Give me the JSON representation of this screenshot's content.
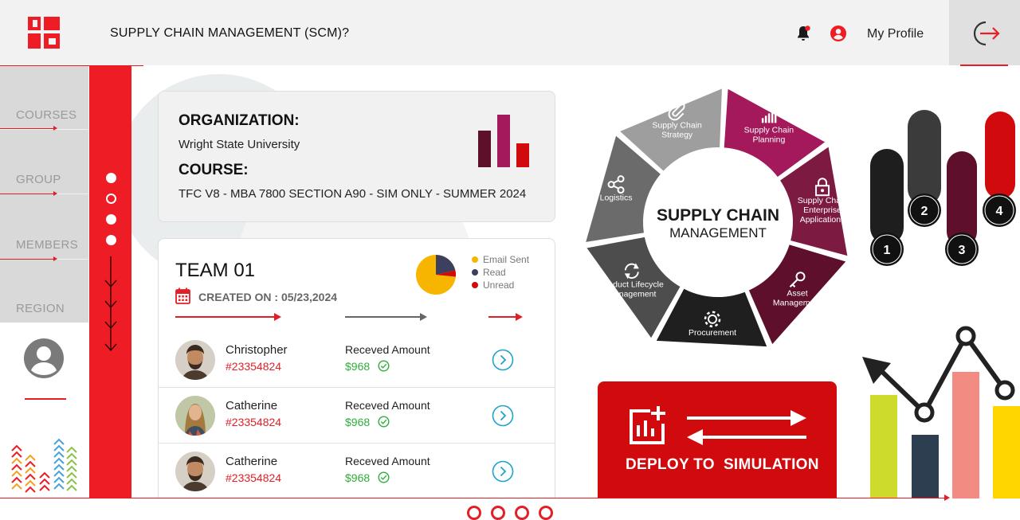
{
  "header": {
    "title": "SUPPLY CHAIN MANAGEMENT (SCM)?",
    "profile_label": "My Profile"
  },
  "sidebar": {
    "items": [
      {
        "label": "COURSES"
      },
      {
        "label": "GROUP"
      },
      {
        "label": "MEMBERS"
      },
      {
        "label": "REGION"
      }
    ]
  },
  "organization": {
    "org_heading": "ORGANIZATION:",
    "org_value": "Wright State University",
    "course_heading": "COURSE:",
    "course_value": "TFC V8 - MBA 7800 SECTION A90 - SIM ONLY - SUMMER 2024"
  },
  "team": {
    "title": "TEAM 01",
    "created": "CREATED ON : 05/23,2024",
    "legend": [
      {
        "label": "Email Sent",
        "color": "#f7b500"
      },
      {
        "label": "Read",
        "color": "#3d3f5e"
      },
      {
        "label": "Unread",
        "color": "#d10a0e"
      }
    ],
    "members": [
      {
        "name": "Christopher",
        "id": "#23354824",
        "amount_label": "Receved Amount",
        "amount": "$968"
      },
      {
        "name": "Catherine",
        "id": "#23354824",
        "amount_label": "Receved Amount",
        "amount": "$968"
      },
      {
        "name": "Catherine",
        "id": "#23354824",
        "amount_label": "Receved Amount",
        "amount": "$968"
      }
    ]
  },
  "scm_wheel": {
    "center_line1": "SUPPLY CHAIN",
    "center_line2": "MANAGEMENT",
    "segments": [
      {
        "line1": "Supply Chain",
        "line2": "Planning",
        "line3": "",
        "icon": "bar-chart-icon",
        "color": "#a3195b"
      },
      {
        "line1": "Supply Chain",
        "line2": "Enterprise",
        "line3": "Applications",
        "icon": "lock-icon",
        "color": "#7d1a42"
      },
      {
        "line1": "Asset",
        "line2": "Management",
        "line3": "",
        "icon": "key-icon",
        "color": "#5e0f2b"
      },
      {
        "line1": "Procurement",
        "line2": "",
        "line3": "",
        "icon": "gear-icon",
        "color": "#1f1f1f"
      },
      {
        "line1": "Product Lifecycle",
        "line2": "Management",
        "line3": "",
        "icon": "refresh-icon",
        "color": "#4d4d4d"
      },
      {
        "line1": "Logistics",
        "line2": "",
        "line3": "",
        "icon": "share-icon",
        "color": "#6b6b6b"
      },
      {
        "line1": "Supply Chain",
        "line2": "Strategy",
        "line3": "",
        "icon": "paperclip-icon",
        "color": "#9e9e9e"
      }
    ]
  },
  "deploy": {
    "label": "DEPLOY TO  SIMULATION"
  },
  "pillars": [
    "1",
    "2",
    "3",
    "4"
  ],
  "pagination": {
    "count": 4
  },
  "colors": {
    "accent": "#ee1c24",
    "deploy": "#d10a0e",
    "amount": "#2fae3a"
  }
}
